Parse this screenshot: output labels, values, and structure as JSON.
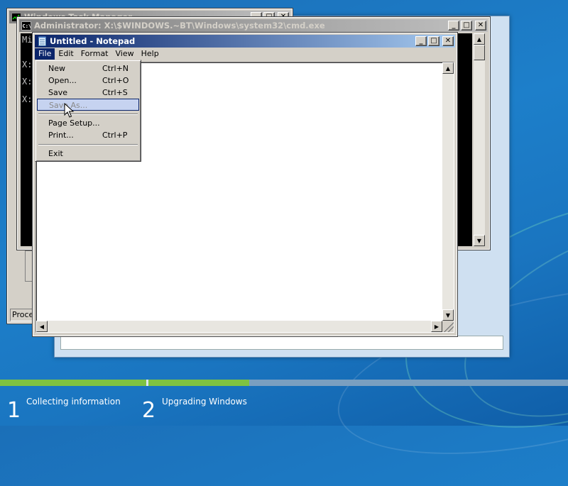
{
  "colors": {
    "progress_done": "#7fc241",
    "progress_track": "#7a9fc0",
    "titlebar_active": "#0a246a",
    "menu_hover": "#c6d3f0"
  },
  "task_manager": {
    "title": "Windows Task Manager",
    "status_text": "Proces"
  },
  "cmd": {
    "title": "Administrator: X:\\$WINDOWS.~BT\\Windows\\system32\\cmd.exe",
    "lines": [
      "Mi",
      "X:",
      "X:",
      "X:"
    ]
  },
  "notepad": {
    "title": "Untitled - Notepad",
    "menu": {
      "file": "File",
      "edit": "Edit",
      "format": "Format",
      "view": "View",
      "help": "Help"
    },
    "file_menu": {
      "new": {
        "label": "New",
        "shortcut": "Ctrl+N"
      },
      "open": {
        "label": "Open...",
        "shortcut": "Ctrl+O"
      },
      "save": {
        "label": "Save",
        "shortcut": "Ctrl+S"
      },
      "save_as": {
        "label": "Save As..."
      },
      "page_setup": {
        "label": "Page Setup..."
      },
      "print": {
        "label": "Print...",
        "shortcut": "Ctrl+P"
      },
      "exit": {
        "label": "Exit"
      }
    }
  },
  "setup": {
    "steps": [
      {
        "number": "1",
        "label": "Collecting information"
      },
      {
        "number": "2",
        "label": "Upgrading Windows"
      }
    ],
    "step1_progress": 1.0,
    "step2_progress": 0.24
  }
}
